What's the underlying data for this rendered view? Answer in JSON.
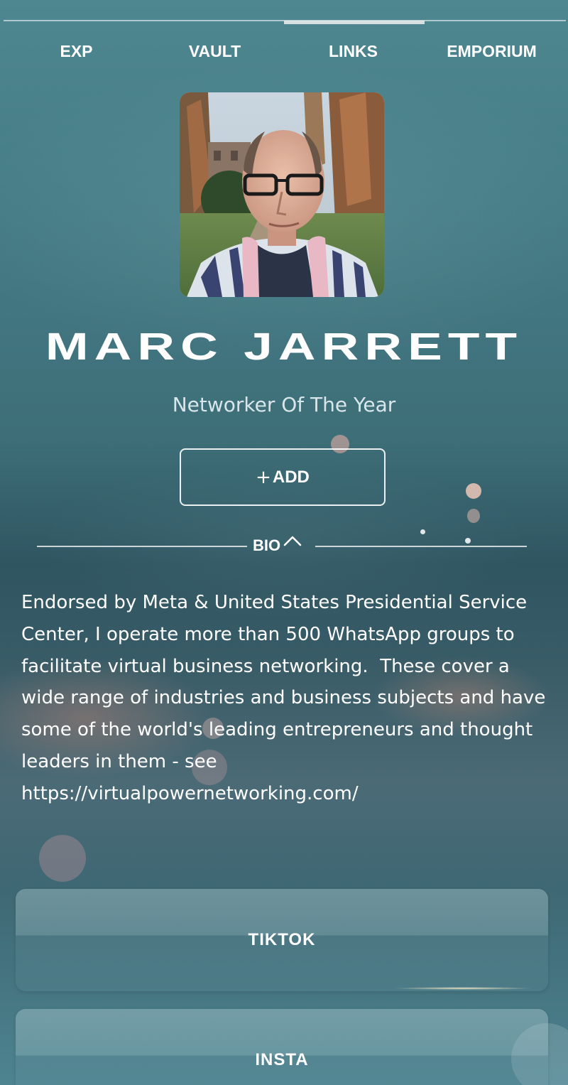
{
  "nav": {
    "tabs": [
      {
        "label": "EXP",
        "active": false
      },
      {
        "label": "VAULT",
        "active": false
      },
      {
        "label": "LINKS",
        "active": true
      },
      {
        "label": "EMPORIUM",
        "active": false
      }
    ]
  },
  "profile": {
    "name": "MARC JARRETT",
    "subtitle": "Networker Of The Year",
    "add_plus": "+",
    "add_label": "ADD"
  },
  "bio": {
    "label": "BIO",
    "toggle_icon": "chevron-up-icon",
    "text": "Endorsed by Meta & United States Presidential Service Center, I operate more than 500 WhatsApp groups to facilitate virtual business networking.  These cover a wide range of industries and business subjects and have some of the world's leading entrepreneurs and thought leaders in them - see https://virtualpowernetworking.com/"
  },
  "links": [
    {
      "label": "TIKTOK"
    },
    {
      "label": "INSTA"
    }
  ],
  "colors": {
    "text": "#ffffff",
    "subtitle": "#d9e6e9",
    "background_top": "#4f8791",
    "background_mid": "#2f5561"
  }
}
